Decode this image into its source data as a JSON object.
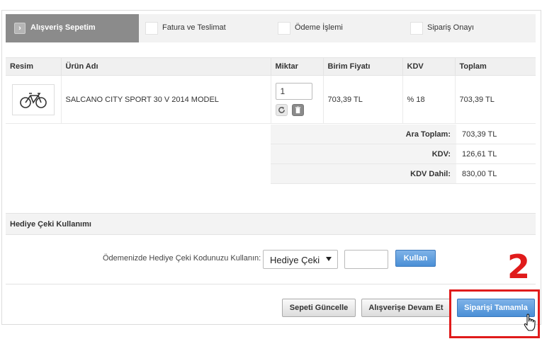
{
  "steps": [
    {
      "label": "Alışveriş Sepetim",
      "active": true
    },
    {
      "label": "Fatura ve Teslimat",
      "active": false
    },
    {
      "label": "Ödeme İşlemi",
      "active": false
    },
    {
      "label": "Sipariş Onayı",
      "active": false
    }
  ],
  "cart": {
    "headers": [
      "Resim",
      "Ürün Adı",
      "Miktar",
      "Birim Fiyatı",
      "KDV",
      "Toplam"
    ],
    "items": [
      {
        "image_icon": "bicycle-icon",
        "name": "SALCANO CITY SPORT 30 V 2014 MODEL",
        "quantity": "1",
        "unit_price": "703,39 TL",
        "kdv": "% 18",
        "total": "703,39 TL"
      }
    ]
  },
  "totals": {
    "subtotal_label": "Ara Toplam:",
    "subtotal_value": "703,39 TL",
    "kdv_label": "KDV:",
    "kdv_value": "126,61 TL",
    "kdv_incl_label": "KDV Dahil:",
    "kdv_incl_value": "830,00 TL"
  },
  "gift": {
    "heading": "Hediye Çeki Kullanımı",
    "label": "Ödemenizde Hediye Çeki Kodunuzu Kullanın:",
    "select_value": "Hediye Çeki",
    "code_value": "",
    "apply_label": "Kullan"
  },
  "actions": {
    "update_label": "Sepeti Güncelle",
    "continue_label": "Alışverişe Devam Et",
    "complete_label": "Siparişi Tamamla"
  },
  "annotation": {
    "step_number": "2",
    "color": "#e01b1b"
  },
  "colors": {
    "accent_blue": "#4a8fd6",
    "active_step": "#8b8b8b"
  }
}
